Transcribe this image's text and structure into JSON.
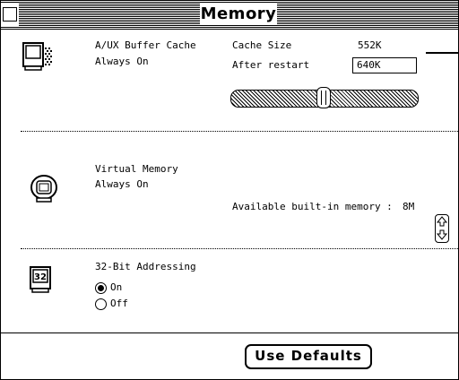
{
  "window": {
    "title": "Memory"
  },
  "cache": {
    "label_line1": "A/UX Buffer Cache",
    "label_line2": "Always On",
    "size_label": "Cache Size",
    "size_value": "552K",
    "restart_label": "After restart",
    "restart_value": "640K"
  },
  "virtual_memory": {
    "label_line1": "Virtual Memory",
    "label_line2": "Always On",
    "available_label": "Available built-in memory :",
    "available_value": "8M"
  },
  "addressing": {
    "label": "32-Bit Addressing",
    "icon_text": "32",
    "options": [
      {
        "label": "On",
        "selected": true
      },
      {
        "label": "Off",
        "selected": false
      }
    ]
  },
  "buttons": {
    "defaults_label": "Use Defaults"
  },
  "icons": [
    "mac-monitor-icon",
    "disk-icon",
    "32bit-icon",
    "up-arrow-icon",
    "down-arrow-icon",
    "close-box-icon"
  ]
}
